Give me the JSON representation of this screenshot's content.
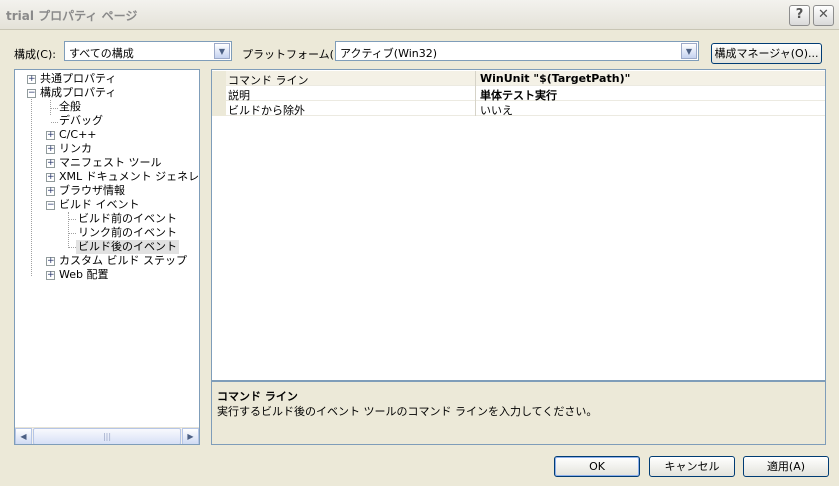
{
  "window": {
    "title": "trial プロパティ ページ",
    "help_glyph": "?",
    "close_glyph": "✕"
  },
  "toolbar": {
    "configuration_label": "構成(C):",
    "configuration_value": "すべての構成",
    "platform_label": "プラットフォーム(P):",
    "platform_value": "アクティブ(Win32)",
    "config_manager_label": "構成マネージャ(O)..."
  },
  "tree": {
    "items": [
      {
        "label": "共通プロパティ",
        "expander": "+"
      },
      {
        "label": "構成プロパティ",
        "expander": "−"
      },
      {
        "label": "全般"
      },
      {
        "label": "デバッグ"
      },
      {
        "label": "C/C++",
        "expander": "+"
      },
      {
        "label": "リンカ",
        "expander": "+"
      },
      {
        "label": "マニフェスト ツール",
        "expander": "+"
      },
      {
        "label": "XML ドキュメント ジェネレータ",
        "expander": "+"
      },
      {
        "label": "ブラウザ情報",
        "expander": "+"
      },
      {
        "label": "ビルド イベント",
        "expander": "−"
      },
      {
        "label": "ビルド前のイベント"
      },
      {
        "label": "リンク前のイベント"
      },
      {
        "label": "ビルド後のイベント",
        "selected": true
      },
      {
        "label": "カスタム ビルド ステップ",
        "expander": "+"
      },
      {
        "label": "Web 配置",
        "expander": "+"
      }
    ],
    "scroll_left": "◀",
    "scroll_right": "▶",
    "scroll_grip": "|||"
  },
  "grid": {
    "rows": [
      {
        "name": "コマンド ライン",
        "value": "WinUnit \"$(TargetPath)\""
      },
      {
        "name": "説明",
        "value": "単体テスト実行"
      },
      {
        "name": "ビルドから除外",
        "value": "いいえ"
      }
    ]
  },
  "description": {
    "title": "コマンド ライン",
    "text": "実行するビルド後のイベント ツールのコマンド ラインを入力してください。"
  },
  "buttons": {
    "ok": "OK",
    "cancel": "キャンセル",
    "apply": "適用(A)"
  },
  "icons": {
    "dropdown_arrow": "▼"
  }
}
